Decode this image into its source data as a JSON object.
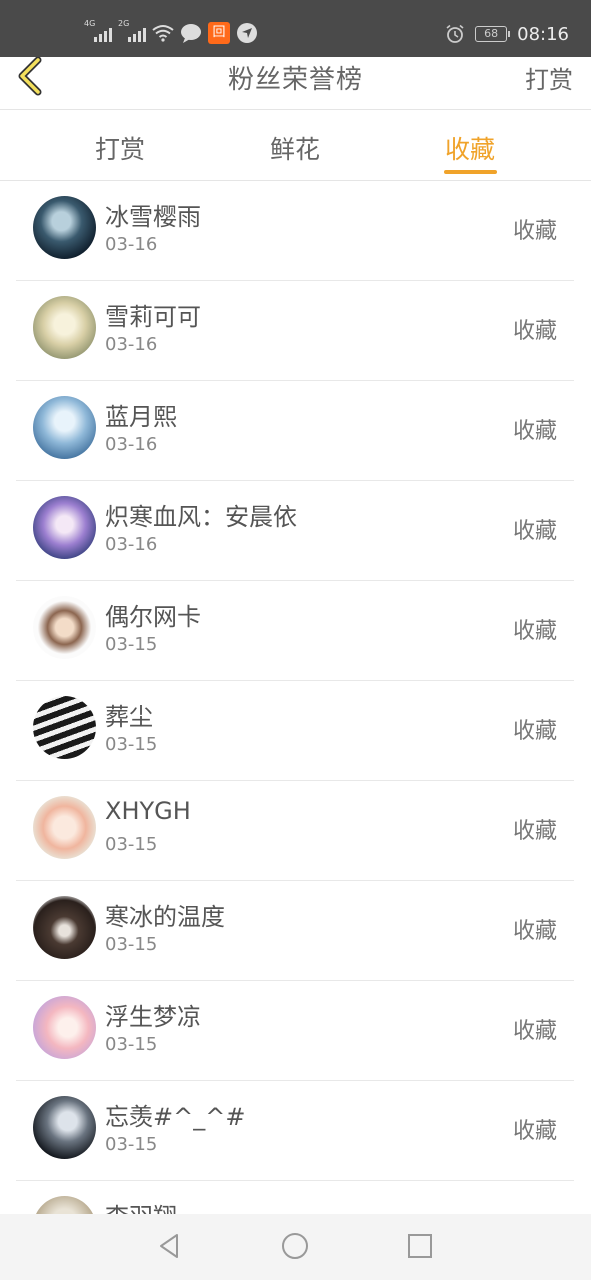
{
  "status_bar": {
    "network_1": "4G",
    "network_2": "2G",
    "battery": "68",
    "time": "08:16",
    "app_badge": "回"
  },
  "header": {
    "title": "粉丝荣誉榜",
    "right_action": "打赏"
  },
  "tabs": [
    {
      "label": "打赏",
      "active": false
    },
    {
      "label": "鲜花",
      "active": false
    },
    {
      "label": "收藏",
      "active": true
    }
  ],
  "accent_color": "#f0a32a",
  "fans": [
    {
      "name": "冰雪樱雨",
      "date": "03-16",
      "action": "收藏"
    },
    {
      "name": "雪莉可可",
      "date": "03-16",
      "action": "收藏"
    },
    {
      "name": "蓝月熙",
      "date": "03-16",
      "action": "收藏"
    },
    {
      "name": "炽寒血风：安晨依",
      "date": "03-16",
      "action": "收藏"
    },
    {
      "name": "偶尔网卡",
      "date": "03-15",
      "action": "收藏"
    },
    {
      "name": "葬尘",
      "date": "03-15",
      "action": "收藏"
    },
    {
      "name": "XHYGH",
      "date": "03-15",
      "action": "收藏"
    },
    {
      "name": "寒冰的温度",
      "date": "03-15",
      "action": "收藏"
    },
    {
      "name": "浮生梦凉",
      "date": "03-15",
      "action": "收藏"
    },
    {
      "name": "忘羡#^_^#",
      "date": "03-15",
      "action": "收藏"
    },
    {
      "name": "李羽翔",
      "date": "",
      "action": ""
    }
  ]
}
